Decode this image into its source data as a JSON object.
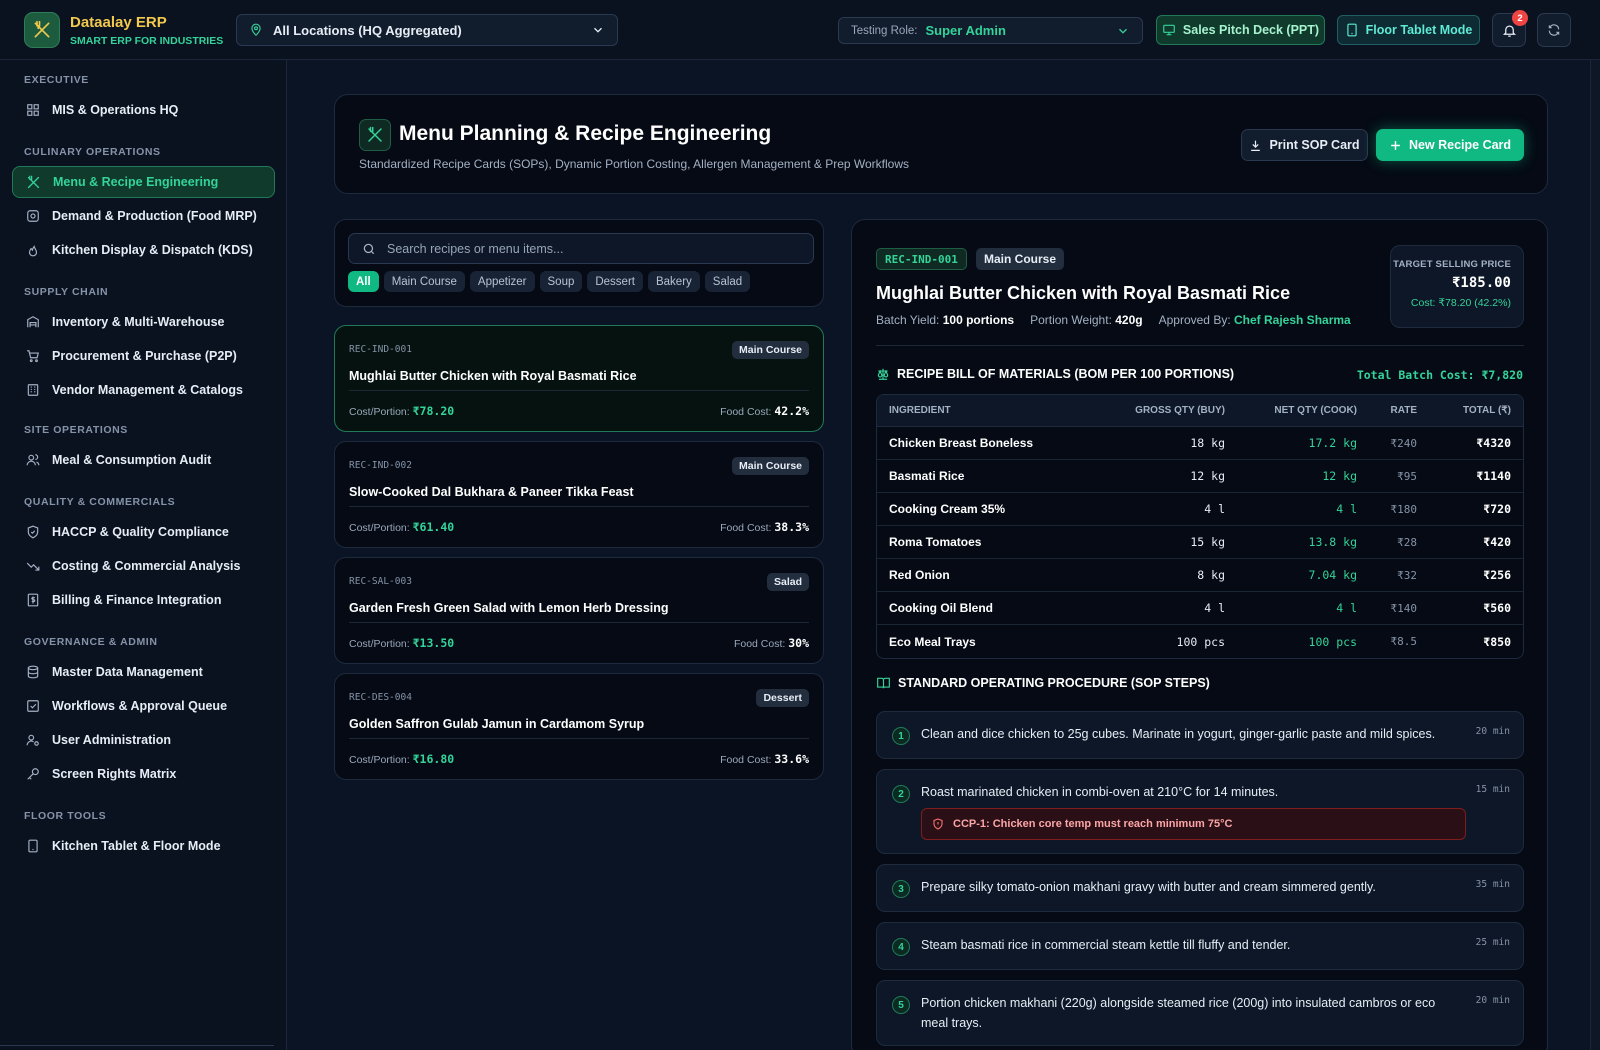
{
  "app": {
    "name": "Dataalay ERP",
    "tagline": "SMART ERP FOR INDUSTRIES"
  },
  "topbar": {
    "location": "All Locations (HQ Aggregated)",
    "role_label": "Testing Role:",
    "role_value": "Super Admin",
    "pitch_button": "Sales Pitch Deck (PPT)",
    "floor_button": "Floor Tablet Mode",
    "notification_count": "2"
  },
  "sidebar": {
    "sections": [
      {
        "title": "EXECUTIVE",
        "items": [
          {
            "label": "MIS & Operations HQ",
            "icon": "grid-icon"
          }
        ]
      },
      {
        "title": "CULINARY OPERATIONS",
        "items": [
          {
            "label": "Menu & Recipe Engineering",
            "icon": "utensils-icon",
            "active": true
          },
          {
            "label": "Demand & Production (Food MRP)",
            "icon": "cog-icon"
          },
          {
            "label": "Kitchen Display & Dispatch (KDS)",
            "icon": "flame-icon"
          }
        ]
      },
      {
        "title": "SUPPLY CHAIN",
        "items": [
          {
            "label": "Inventory & Multi-Warehouse",
            "icon": "warehouse-icon"
          },
          {
            "label": "Procurement & Purchase (P2P)",
            "icon": "cart-icon"
          },
          {
            "label": "Vendor Management & Catalogs",
            "icon": "building-icon"
          }
        ]
      },
      {
        "title": "SITE OPERATIONS",
        "items": [
          {
            "label": "Meal & Consumption Audit",
            "icon": "users-icon"
          }
        ]
      },
      {
        "title": "QUALITY & COMMERCIALS",
        "items": [
          {
            "label": "HACCP & Quality Compliance",
            "icon": "shield-icon"
          },
          {
            "label": "Costing & Commercial Analysis",
            "icon": "trend-icon"
          },
          {
            "label": "Billing & Finance Integration",
            "icon": "receipt-icon"
          }
        ]
      },
      {
        "title": "GOVERNANCE & ADMIN",
        "items": [
          {
            "label": "Master Data Management",
            "icon": "database-icon"
          },
          {
            "label": "Workflows & Approval Queue",
            "icon": "checkbox-icon"
          },
          {
            "label": "User Administration",
            "icon": "user-cog-icon"
          },
          {
            "label": "Screen Rights Matrix",
            "icon": "key-icon"
          }
        ]
      },
      {
        "title": "FLOOR TOOLS",
        "items": [
          {
            "label": "Kitchen Tablet & Floor Mode",
            "icon": "tablet-icon"
          }
        ]
      }
    ]
  },
  "page": {
    "title": "Menu Planning & Recipe Engineering",
    "subtitle": "Standardized Recipe Cards (SOPs), Dynamic Portion Costing, Allergen Management & Prep Workflows",
    "print_button": "Print SOP Card",
    "new_button": "New Recipe Card"
  },
  "search": {
    "placeholder": "Search recipes or menu items...",
    "filters": [
      "All",
      "Main Course",
      "Appetizer",
      "Soup",
      "Dessert",
      "Bakery",
      "Salad"
    ],
    "active_filter": "All"
  },
  "recipes": [
    {
      "code": "REC-IND-001",
      "category": "Main Course",
      "title": "Mughlai Butter Chicken with Royal Basmati Rice",
      "cost_label": "Cost/Portion:",
      "cost": "₹78.20",
      "food_label": "Food Cost:",
      "food_cost": "42.2%",
      "active": true
    },
    {
      "code": "REC-IND-002",
      "category": "Main Course",
      "title": "Slow-Cooked Dal Bukhara & Paneer Tikka Feast",
      "cost_label": "Cost/Portion:",
      "cost": "₹61.40",
      "food_label": "Food Cost:",
      "food_cost": "38.3%"
    },
    {
      "code": "REC-SAL-003",
      "category": "Salad",
      "title": "Garden Fresh Green Salad with Lemon Herb Dressing",
      "cost_label": "Cost/Portion:",
      "cost": "₹13.50",
      "food_label": "Food Cost:",
      "food_cost": "30%"
    },
    {
      "code": "REC-DES-004",
      "category": "Dessert",
      "title": "Golden Saffron Gulab Jamun in Cardamom Syrup",
      "cost_label": "Cost/Portion:",
      "cost": "₹16.80",
      "food_label": "Food Cost:",
      "food_cost": "33.6%"
    }
  ],
  "detail": {
    "code": "REC-IND-001",
    "category": "Main Course",
    "title": "Mughlai Butter Chicken with Royal Basmati Rice",
    "batch_yield_label": "Batch Yield:",
    "batch_yield": "100 portions",
    "portion_weight_label": "Portion Weight:",
    "portion_weight": "420g",
    "approved_label": "Approved By:",
    "approved_by": "Chef Rajesh Sharma",
    "price_label": "TARGET SELLING PRICE",
    "price": "₹185.00",
    "price_cost": "Cost: ₹78.20 (42.2%)",
    "bom_title": "RECIPE BILL OF MATERIALS (BOM PER 100 PORTIONS)",
    "bom_total": "Total Batch Cost: ₹7,820",
    "bom_columns": [
      "INGREDIENT",
      "GROSS QTY (BUY)",
      "NET QTY (COOK)",
      "RATE",
      "TOTAL (₹)"
    ],
    "bom_rows": [
      [
        "Chicken Breast Boneless",
        "18 kg",
        "17.2 kg",
        "₹240",
        "₹4320"
      ],
      [
        "Basmati Rice",
        "12 kg",
        "12 kg",
        "₹95",
        "₹1140"
      ],
      [
        "Cooking Cream 35%",
        "4 l",
        "4 l",
        "₹180",
        "₹720"
      ],
      [
        "Roma Tomatoes",
        "15 kg",
        "13.8 kg",
        "₹28",
        "₹420"
      ],
      [
        "Red Onion",
        "8 kg",
        "7.04 kg",
        "₹32",
        "₹256"
      ],
      [
        "Cooking Oil Blend",
        "4 l",
        "4 l",
        "₹140",
        "₹560"
      ],
      [
        "Eco Meal Trays",
        "100 pcs",
        "100 pcs",
        "₹8.5",
        "₹850"
      ]
    ],
    "sop_title": "STANDARD OPERATING PROCEDURE (SOP STEPS)",
    "sop_steps": [
      {
        "num": "1",
        "text": "Clean and dice chicken to 25g cubes. Marinate in yogurt, ginger-garlic paste and mild spices.",
        "time": "20 min"
      },
      {
        "num": "2",
        "text": "Roast marinated chicken in combi-oven at 210°C for 14 minutes.",
        "time": "15 min",
        "ccp": "CCP-1: Chicken core temp must reach minimum 75°C"
      },
      {
        "num": "3",
        "text": "Prepare silky tomato-onion makhani gravy with butter and cream simmered gently.",
        "time": "35 min"
      },
      {
        "num": "4",
        "text": "Steam basmati rice in commercial steam kettle till fluffy and tender.",
        "time": "25 min"
      },
      {
        "num": "5",
        "text": "Portion chicken makhani (220g) alongside steamed rice (200g) into insulated cambros or eco meal trays.",
        "time": "20 min"
      }
    ]
  },
  "colors": {
    "accent": "#10b981",
    "accent_text": "#34d399",
    "brand": "#f2c94c",
    "danger": "#fca5a5"
  }
}
